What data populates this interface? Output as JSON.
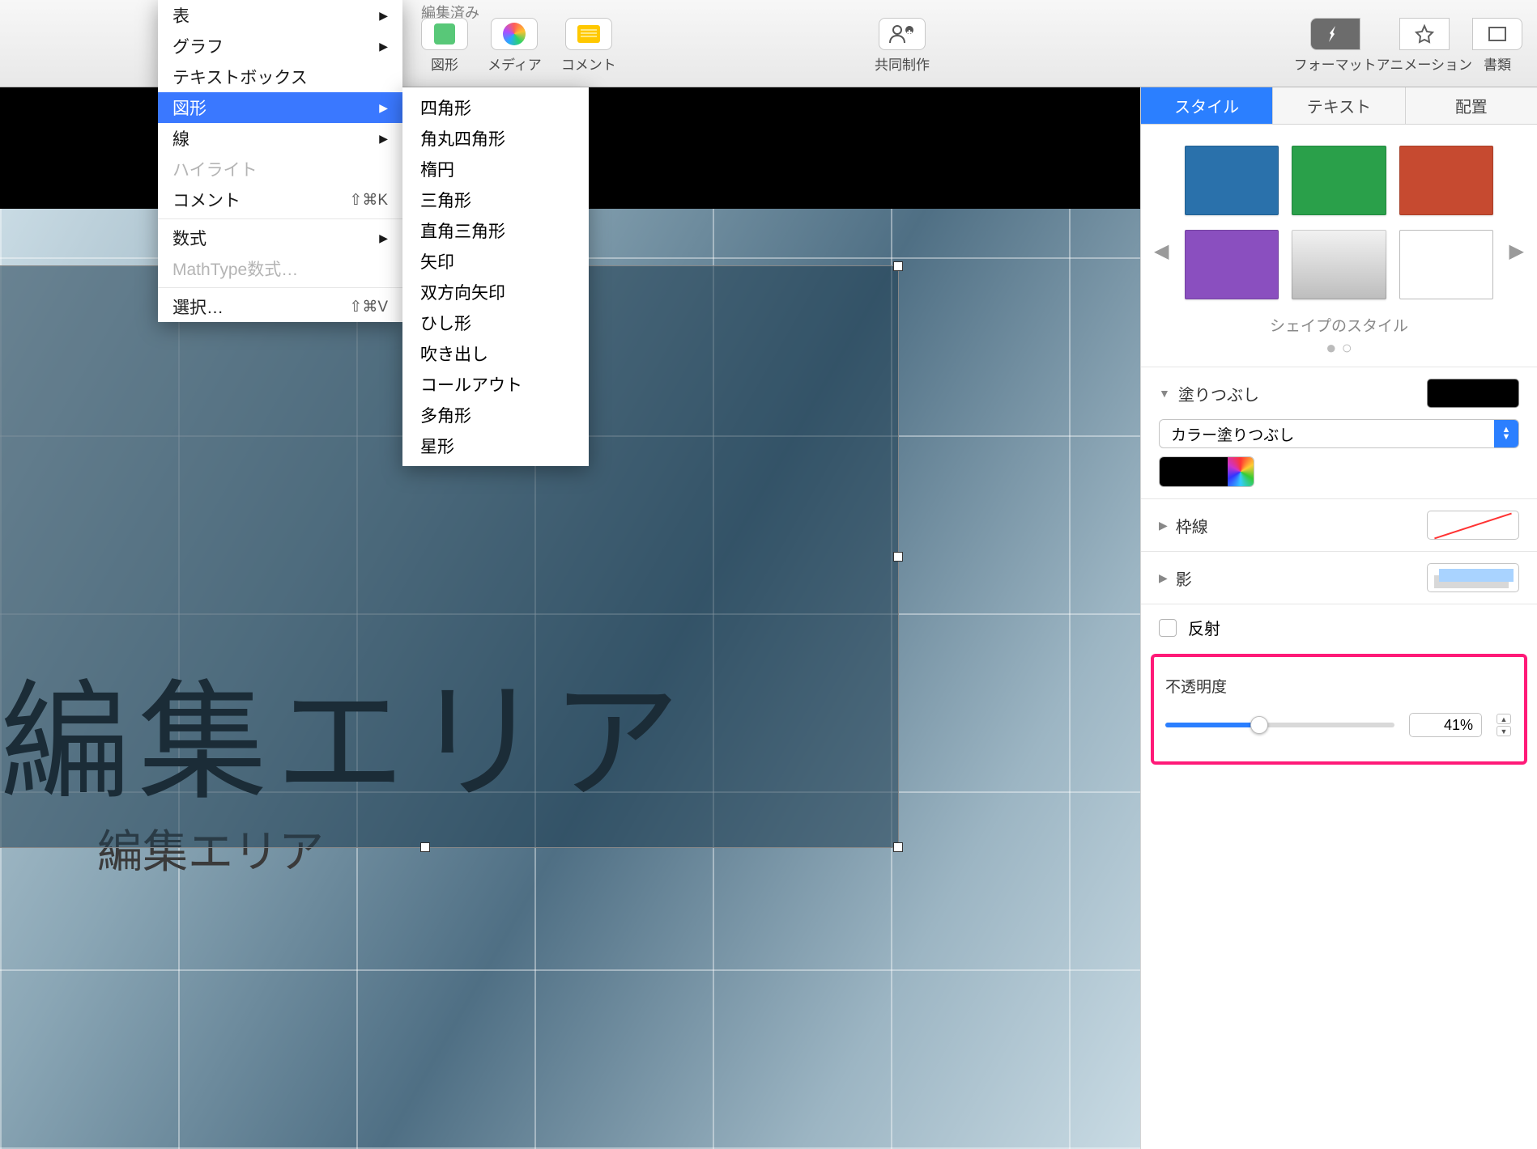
{
  "title_fragment": "編集済み",
  "toolbar": {
    "shape": "図形",
    "media": "メディア",
    "comment": "コメント",
    "collaborate": "共同制作",
    "format": "フォーマット",
    "animate": "アニメーション",
    "document": "書類"
  },
  "menu": {
    "table": "表",
    "chart": "グラフ",
    "textbox": "テキストボックス",
    "shape": "図形",
    "line": "線",
    "highlight": "ハイライト",
    "comment": "コメント",
    "comment_shortcut": "⇧⌘K",
    "formula": "数式",
    "mathtype": "MathType数式…",
    "select": "選択…",
    "select_shortcut": "⇧⌘V"
  },
  "submenu": {
    "items": [
      "四角形",
      "角丸四角形",
      "楕円",
      "三角形",
      "直角三角形",
      "矢印",
      "双方向矢印",
      "ひし形",
      "吹き出し",
      "コールアウト",
      "多角形",
      "星形"
    ]
  },
  "canvas": {
    "title": "編集エリア",
    "subtitle": "編集エリア"
  },
  "inspector": {
    "tabs": {
      "style": "スタイル",
      "text": "テキスト",
      "arrange": "配置"
    },
    "styles_title": "シェイプのスタイル",
    "swatches": [
      "#2a71ab",
      "#2aa04a",
      "#c64a30",
      "#8a4fbf",
      "#d8d8d8",
      "#ffffff"
    ],
    "fill": {
      "label": "塗りつぶし",
      "type": "カラー塗りつぶし"
    },
    "stroke": {
      "label": "枠線"
    },
    "shadow": {
      "label": "影"
    },
    "reflect": {
      "label": "反射"
    },
    "opacity": {
      "label": "不透明度",
      "value": "41%"
    }
  }
}
